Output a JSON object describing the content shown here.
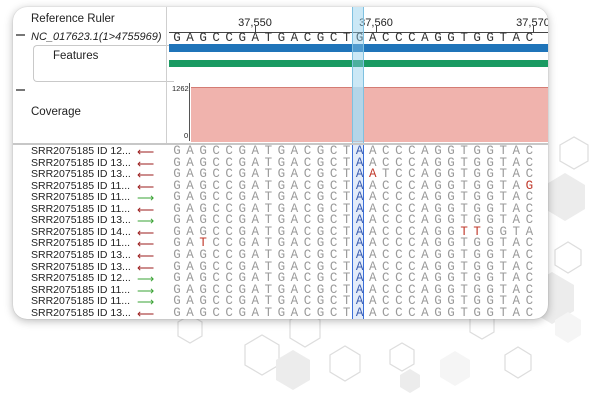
{
  "track_labels": {
    "ruler": "Reference Ruler",
    "reference": "NC_017623.1(1>4755969)",
    "features": "Features",
    "coverage": "Coverage"
  },
  "ruler_ticks": [
    "37,550",
    "37,560",
    "37,570"
  ],
  "reference_sequence": "GAGCCGATGACGCTGACCCAGGTGGTAC",
  "coverage_axis": {
    "max": "1262",
    "min": "0"
  },
  "colors": {
    "forward": "#3aa335",
    "reverse": "#9b1b1b",
    "mismatch": "#c0392b",
    "coverage": "#f0b3ad",
    "feature_blue": "#1f74b9",
    "feature_green": "#1a9a62"
  },
  "reads": [
    {
      "label": "SRR2075185 ID 12...",
      "strand": "reverse",
      "sequence": "GAGCCGATGACGCTACCCAGGTGGTAC",
      "mismatch": []
    },
    {
      "label": "SRR2075185 ID 13...",
      "strand": "reverse",
      "sequence": "GAGCCGATGACGCTACCCAGGTGGTAC",
      "mismatch": []
    },
    {
      "label": "SRR2075185 ID 13...",
      "strand": "reverse",
      "sequence": "GAGCCGATGACGCTATCCAGGTGGTAC",
      "mismatch": [
        15
      ]
    },
    {
      "label": "SRR2075185 ID 11...",
      "strand": "reverse",
      "sequence": "GAGCCGATGACGCTACCCAGGTGGTAG",
      "mismatch": [
        27
      ]
    },
    {
      "label": "SRR2075185 ID 11...",
      "strand": "forward",
      "sequence": "GAGCCGATGACGCTACCCAGGTGGTAC",
      "mismatch": []
    },
    {
      "label": "SRR2075185 ID 11...",
      "strand": "reverse",
      "sequence": "GAGCCGATGACGCTACCCAGGTGGTAC",
      "mismatch": []
    },
    {
      "label": "SRR2075185 ID 13...",
      "strand": "forward",
      "sequence": "GAGCCGATGACGCTACCCAGGTGGTAC",
      "mismatch": []
    },
    {
      "label": "SRR2075185 ID 14...",
      "strand": "reverse",
      "sequence": "GAGCCGATGACGCTACCCAGGTTGGTAC",
      "mismatch": [
        22,
        23
      ]
    },
    {
      "label": "SRR2075185 ID 11...",
      "strand": "reverse",
      "sequence": "GATCCGATGACGCTACCCAGGTGGTAC",
      "mismatch": [
        2
      ]
    },
    {
      "label": "SRR2075185 ID 13...",
      "strand": "reverse",
      "sequence": "GAGCCGATGACGCTACCCAGGTGGTAC",
      "mismatch": []
    },
    {
      "label": "SRR2075185 ID 13...",
      "strand": "reverse",
      "sequence": "GAGCCGATGACGCTACCCAGGTGGTAC",
      "mismatch": []
    },
    {
      "label": "SRR2075185 ID 12...",
      "strand": "forward",
      "sequence": "GAGCCGATGACGCTACCCAGGTGGTAC",
      "mismatch": []
    },
    {
      "label": "SRR2075185 ID 11...",
      "strand": "forward",
      "sequence": "GAGCCGATGACGCTACCCAGGTGGTAC",
      "mismatch": []
    },
    {
      "label": "SRR2075185 ID 11...",
      "strand": "forward",
      "sequence": "GAGCCGATGACGCTACCCAGGTGGTAC",
      "mismatch": []
    },
    {
      "label": "SRR2075185 ID 13...",
      "strand": "reverse",
      "sequence": "GAGCCGATGACGCTACCCAGGTGGTAC",
      "mismatch": []
    }
  ]
}
